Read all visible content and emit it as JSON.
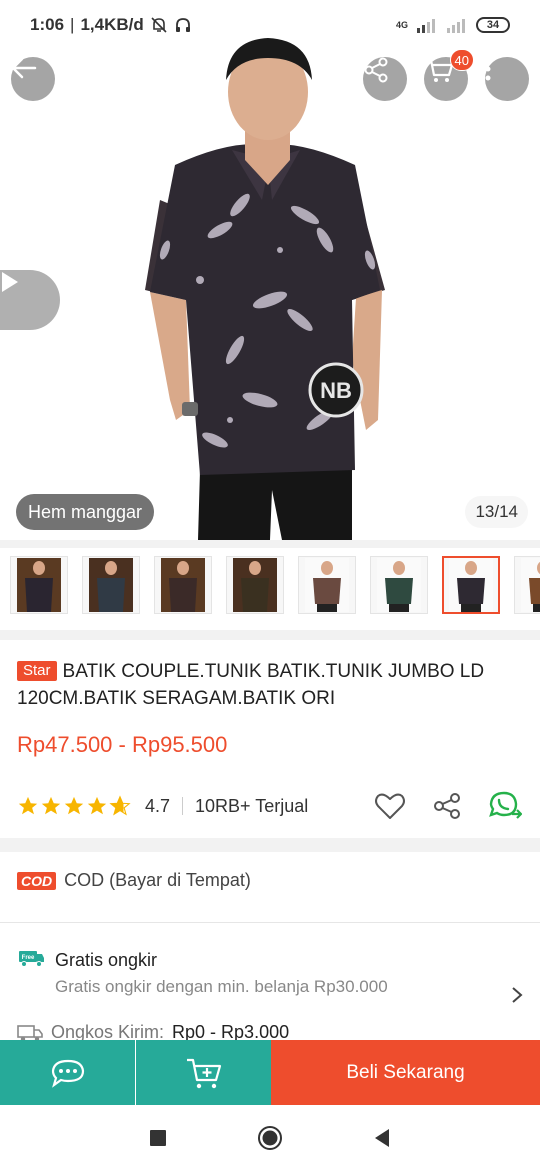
{
  "status_bar": {
    "time": "1:06",
    "speed": "1,4KB/d",
    "network": "4G",
    "battery": "34"
  },
  "hero": {
    "variant_label": "Hem manggar",
    "image_counter": "13/14",
    "watermark": "NB",
    "cart_count": "40",
    "icons": {
      "back": "arrow-left-icon",
      "share": "share-icon",
      "cart": "cart-icon",
      "more": "more-vertical-icon",
      "video": "play-icon"
    }
  },
  "thumbnails": {
    "count_visible": 8,
    "active_index": 6
  },
  "product": {
    "badge": "Star",
    "title": "BATIK COUPLE.TUNIK BATIK.TUNIK JUMBO LD 120CM.BATIK SERAGAM.BATIK ORI",
    "price": "Rp47.500 - Rp95.500",
    "rating": "4.7",
    "stars_fraction": 0.94,
    "sold": "10RB+ Terjual"
  },
  "cod": {
    "badge": "COD",
    "label": "COD (Bayar di Tempat)"
  },
  "shipping": {
    "free_badge": "Free",
    "title": "Gratis ongkir",
    "subtitle": "Gratis ongkir dengan min. belanja Rp30.000",
    "cost_label": "Ongkos Kirim:",
    "cost_value": "Rp0 - Rp3.000"
  },
  "bottom_bar": {
    "buy_label": "Beli Sekarang"
  },
  "colors": {
    "accent": "#ee4d2d",
    "teal": "#26aa99",
    "rating_star": "#f7b500",
    "whatsapp": "#25b14a"
  }
}
